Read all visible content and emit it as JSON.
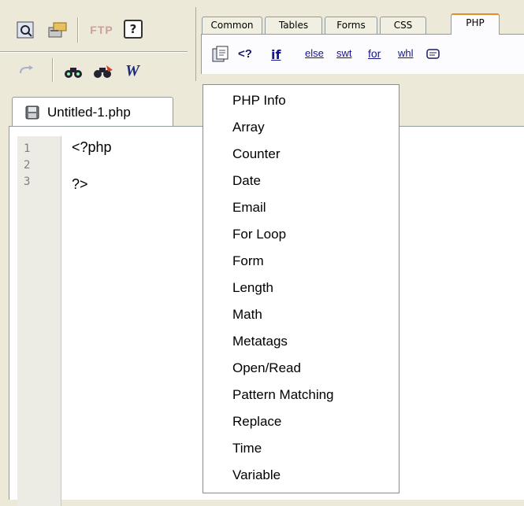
{
  "toolbar": {
    "ftp_label": "FTP",
    "help_label": "?"
  },
  "tabs": [
    {
      "label": "Common"
    },
    {
      "label": "Tables"
    },
    {
      "label": "Forms"
    },
    {
      "label": "CSS"
    },
    {
      "label": "PHP",
      "active": true
    }
  ],
  "php_toolbar": {
    "php_tag": "<?",
    "if": "if",
    "else": "else",
    "switch": "swt",
    "for": "for",
    "while": "whl"
  },
  "document": {
    "tab_title": "Untitled-1.php",
    "line_numbers": [
      "1",
      "2",
      "3"
    ],
    "lines": [
      "<?php",
      "",
      "?>"
    ]
  },
  "menu": {
    "items": [
      "PHP Info",
      "Array",
      "Counter",
      "Date",
      "Email",
      "For Loop",
      "Form",
      "Length",
      "Math",
      "Metatags",
      "Open/Read",
      "Pattern Matching",
      "Replace",
      "Time",
      "Variable"
    ]
  },
  "colors": {
    "active_tab_accent": "#e68b2c",
    "php_button_text": "#14148c",
    "gutter": "#ecebe4"
  }
}
